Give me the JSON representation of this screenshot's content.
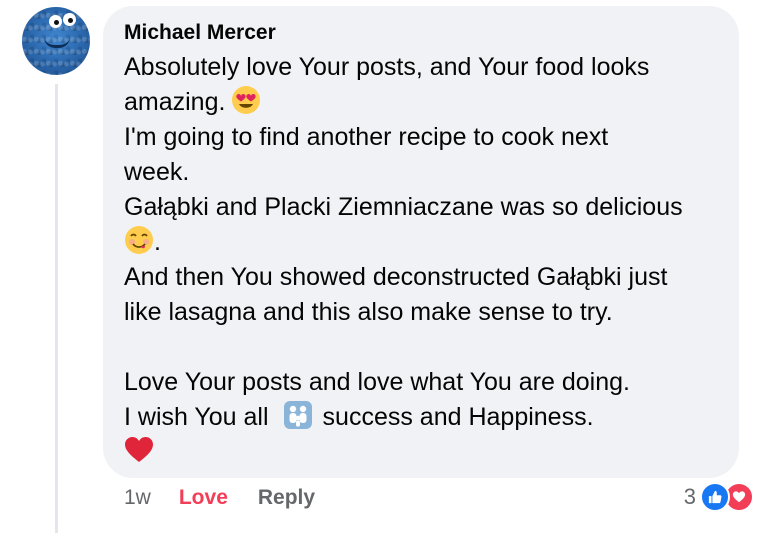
{
  "comment": {
    "author": "Michael Mercer",
    "lines": [
      "Absolutely love Your posts, and Your food looks",
      "amazing.",
      "I'm going to find another recipe to cook next",
      "week.",
      "Gałąbki and Placki Ziemniaczane was so delicious",
      ".",
      "And then You showed deconstructed Gałąbki just",
      "like lasagna and this also make sense to try.",
      "",
      "Love Your posts and love what You are doing.",
      "I wish You all",
      "success and Happiness."
    ],
    "emojis": {
      "heart_eyes": "heart-eyes-emoji",
      "yum": "yum-emoji",
      "family": "family-emoji",
      "red_heart": "red-heart-emoji"
    }
  },
  "footer": {
    "time": "1w",
    "love_label": "Love",
    "reply_label": "Reply"
  },
  "reactions": {
    "count": "3",
    "types": [
      "like",
      "love"
    ]
  },
  "colors": {
    "bubble_bg": "#f0f2f5",
    "love_accent": "#f33e58",
    "like_blue": "#1877f2",
    "meta_gray": "#65676b"
  }
}
